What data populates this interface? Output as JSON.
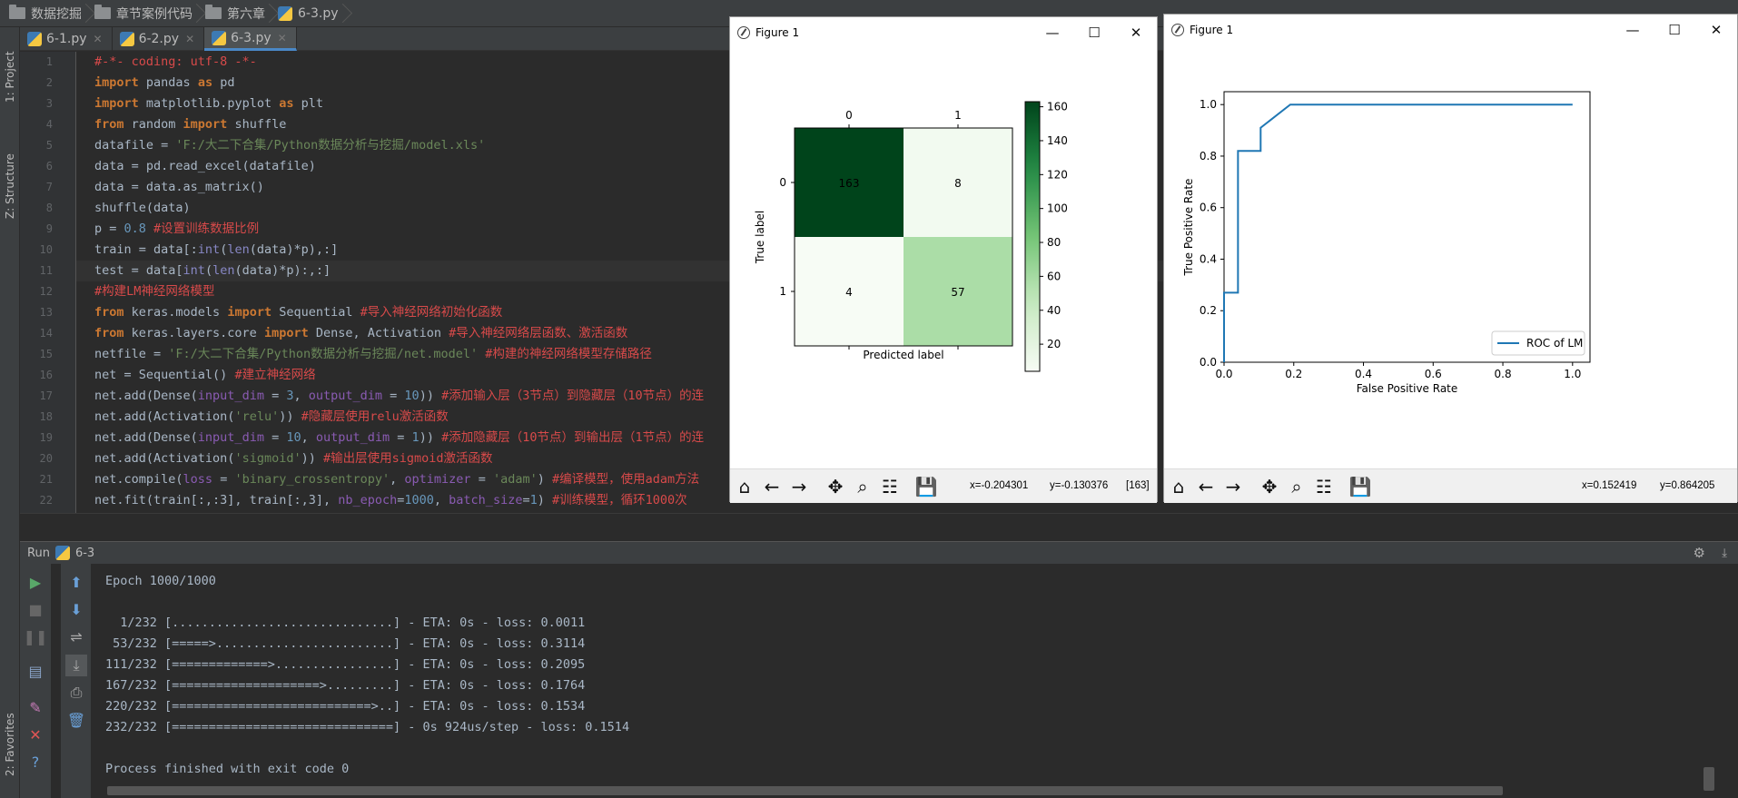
{
  "breadcrumb": [
    {
      "label": "数据挖掘",
      "icon": "folder-icon"
    },
    {
      "label": "章节案例代码",
      "icon": "folder-icon"
    },
    {
      "label": "第六章",
      "icon": "folder-icon"
    },
    {
      "label": "6-3.py",
      "icon": "python-file-icon"
    }
  ],
  "side_tabs": {
    "project": "1: Project",
    "structure": "Z: Structure",
    "favorites": "2: Favorites"
  },
  "file_tabs": [
    {
      "label": "6-1.py",
      "active": false
    },
    {
      "label": "6-2.py",
      "active": false
    },
    {
      "label": "6-3.py",
      "active": true
    }
  ],
  "code": {
    "line_numbers": [
      "1",
      "2",
      "3",
      "4",
      "5",
      "6",
      "7",
      "8",
      "9",
      "10",
      "11",
      "12",
      "13",
      "14",
      "15",
      "16",
      "17",
      "18",
      "19",
      "20",
      "21",
      "22"
    ],
    "l1": {
      "text": "#-*- coding: utf-8 -*-"
    },
    "l2": {
      "kw1": "import",
      "t1": " pandas ",
      "kw2": "as",
      "t2": " pd"
    },
    "l3": {
      "kw1": "import",
      "t1": " matplotlib.pyplot ",
      "kw2": "as",
      "t2": " plt"
    },
    "l4": {
      "kw1": "from",
      "t1": " random ",
      "kw2": "import",
      "t2": " shuffle"
    },
    "l5": {
      "t1": "datafile = ",
      "s1": "'F:/大二下合集/Python数据分析与挖掘/model.xls'"
    },
    "l6": {
      "t1": "data = pd.read_excel(datafile)"
    },
    "l7": {
      "t1": "data = data.as_matrix()"
    },
    "l8": {
      "t1": "shuffle(data)"
    },
    "l9": {
      "t1": "p = ",
      "n1": "0.8",
      "c1": " #设置训练数据比例"
    },
    "l10": {
      "t1": "train = data[:",
      "b1": "int",
      "t2": "(",
      "b2": "len",
      "t3": "(data)*p),:]"
    },
    "l11": {
      "t1": "test = data[",
      "b1": "int",
      "t2": "(",
      "b2": "len",
      "t3": "(data)*p):,:]"
    },
    "l12": {
      "c1": "#构建LM神经网络模型"
    },
    "l13": {
      "kw1": "from",
      "t1": " keras.models ",
      "kw2": "import",
      "t2": " Sequential ",
      "c1": "#导入神经网络初始化函数"
    },
    "l14": {
      "kw1": "from",
      "t1": " keras.layers.core ",
      "kw2": "import",
      "t2": " Dense, Activation ",
      "c1": "#导入神经网络层函数、激活函数"
    },
    "l15": {
      "t1": "netfile = ",
      "s1": "'F:/大二下合集/Python数据分析与挖掘/net.model'",
      "c1": " #构建的神经网络模型存储路径"
    },
    "l16": {
      "t1": "net = Sequential() ",
      "c1": "#建立神经网络"
    },
    "l17": {
      "t1": "net.add(Dense(",
      "p1": "input_dim",
      "t2": " = ",
      "n1": "3",
      "t3": ", ",
      "p2": "output_dim",
      "t4": " = ",
      "n2": "10",
      "t5": ")) ",
      "c1": "#添加输入层（3节点）到隐藏层（10节点）的连"
    },
    "l18": {
      "t1": "net.add(Activation(",
      "s1": "'relu'",
      "t2": ")) ",
      "c1": "#隐藏层使用relu激活函数"
    },
    "l19": {
      "t1": "net.add(Dense(",
      "p1": "input_dim",
      "t2": " = ",
      "n1": "10",
      "t3": ", ",
      "p2": "output_dim",
      "t4": " = ",
      "n2": "1",
      "t5": ")) ",
      "c1": "#添加隐藏层（10节点）到输出层（1节点）的连"
    },
    "l20": {
      "t1": "net.add(Activation(",
      "s1": "'sigmoid'",
      "t2": ")) ",
      "c1": "#输出层使用sigmoid激活函数"
    },
    "l21": {
      "t1": "net.compile(",
      "p1": "loss",
      "t2": " = ",
      "s1": "'binary_crossentropy'",
      "t3": ", ",
      "p2": "optimizer",
      "t4": " = ",
      "s2": "'adam'",
      "t5": ") ",
      "c1": "#编译模型，使用adam方法"
    },
    "l22": {
      "t1": "net.fit(train[:,:3], train[:,3], ",
      "p1": "nb_epoch",
      "t2": "=",
      "n1": "1000",
      "t3": ", ",
      "p2": "batch_size",
      "t4": "=",
      "n2": "1",
      "t5": ") ",
      "c1": "#训练模型，循环1000次"
    }
  },
  "run": {
    "label": "Run",
    "config": "6-3",
    "console": [
      "Epoch 1000/1000",
      "",
      "  1/232 [..............................] - ETA: 0s - loss: 0.0011",
      " 53/232 [=====>........................] - ETA: 0s - loss: 0.3114",
      "111/232 [=============>................] - ETA: 0s - loss: 0.2095",
      "167/232 [====================>.........] - ETA: 0s - loss: 0.1764",
      "220/232 [===========================>..] - ETA: 0s - loss: 0.1534",
      "232/232 [==============================] - 0s 924us/step - loss: 0.1514",
      "",
      "Process finished with exit code 0"
    ]
  },
  "figure1": {
    "title": "Figure 1",
    "coords": {
      "x": "x=-0.204301",
      "y": "y=-0.130376",
      "val": "[163]"
    },
    "chart_data": {
      "type": "heatmap",
      "matrix": [
        [
          163,
          8
        ],
        [
          4,
          57
        ]
      ],
      "x_ticks": [
        "0",
        "1"
      ],
      "y_ticks": [
        "0",
        "1"
      ],
      "xlabel": "Predicted label",
      "ylabel": "True label",
      "colorbar": {
        "min": 4,
        "max": 163,
        "ticks": [
          "160",
          "140",
          "120",
          "100",
          "80",
          "60",
          "40",
          "20"
        ],
        "tick_values": [
          160,
          140,
          120,
          100,
          80,
          60,
          40,
          20
        ]
      },
      "colormap": "Greens"
    }
  },
  "figure2": {
    "title": "Figure 1",
    "coords": {
      "x": "x=0.152419",
      "y": "y=0.864205"
    },
    "chart_data": {
      "type": "line",
      "series": [
        {
          "name": "ROC of LM",
          "color": "#1f77b4",
          "x": [
            0.0,
            0.0,
            0.04,
            0.04,
            0.105,
            0.105,
            0.19,
            1.0
          ],
          "y": [
            0.0,
            0.27,
            0.27,
            0.82,
            0.82,
            0.91,
            1.0,
            1.0
          ]
        }
      ],
      "xlabel": "False Positive Rate",
      "ylabel": "True Positive Rate",
      "xlim": [
        0.0,
        1.05
      ],
      "ylim": [
        0.0,
        1.05
      ],
      "x_ticks": [
        "0.0",
        "0.2",
        "0.4",
        "0.6",
        "0.8",
        "1.0"
      ],
      "x_tick_values": [
        0,
        0.2,
        0.4,
        0.6,
        0.8,
        1.0
      ],
      "y_ticks": [
        "0.0",
        "0.2",
        "0.4",
        "0.6",
        "0.8",
        "1.0"
      ],
      "y_tick_values": [
        0,
        0.2,
        0.4,
        0.6,
        0.8,
        1.0
      ],
      "legend_position": "lower right"
    }
  },
  "window_controls": {
    "minimize": "—",
    "maximize": "☐",
    "close": "✕"
  }
}
